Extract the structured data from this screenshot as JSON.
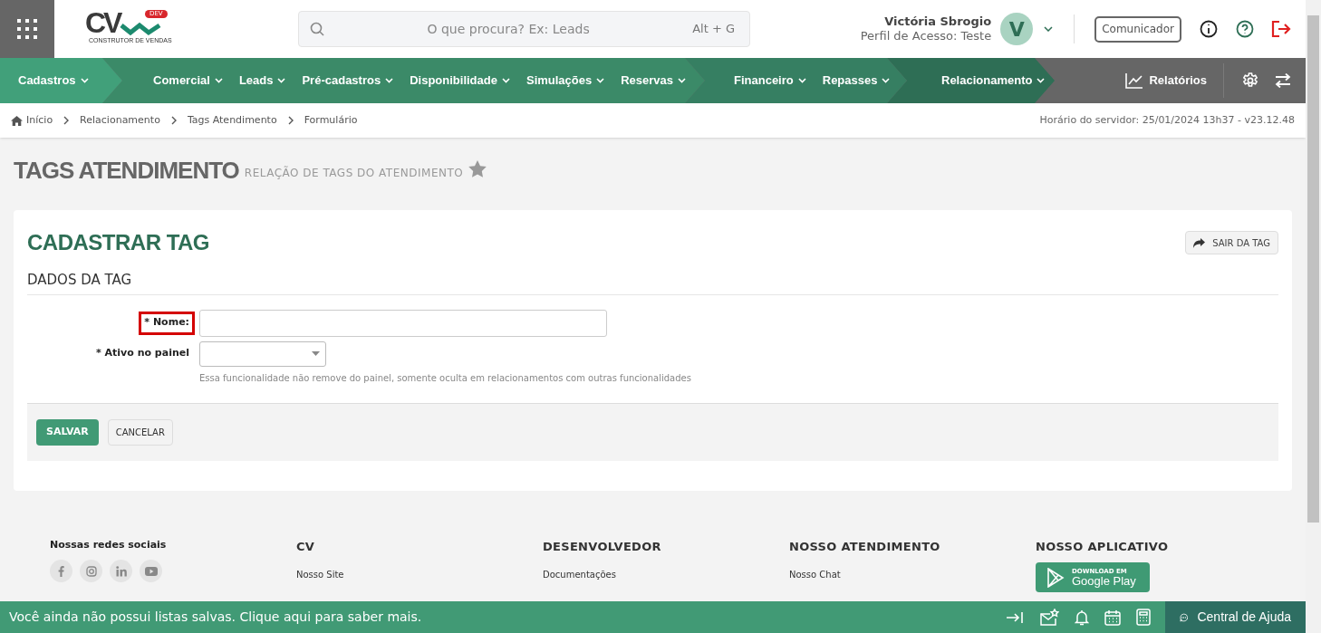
{
  "header": {
    "logo": {
      "mark": "CV",
      "badge": "DEV",
      "tagline": "CONSTRUTOR DE VENDAS"
    },
    "search": {
      "placeholder": "O que procura? Ex: Leads",
      "shortcut": "Alt + G"
    },
    "user": {
      "name": "Victória Sbrogio",
      "profile": "Perfil de Acesso: Teste",
      "initial": "V"
    },
    "communicator": "Comunicador"
  },
  "nav": {
    "groups": [
      {
        "items": [
          "Cadastros"
        ]
      },
      {
        "items": [
          "Comercial",
          "Leads",
          "Pré-cadastros",
          "Disponibilidade",
          "Simulações",
          "Reservas"
        ]
      },
      {
        "items": [
          "Financeiro",
          "Repasses"
        ]
      },
      {
        "items": [
          "Relacionamento"
        ]
      }
    ],
    "reports": "Relatórios"
  },
  "breadcrumb": [
    "Início",
    "Relacionamento",
    "Tags Atendimento",
    "Formulário"
  ],
  "server_time": "Horário do servidor: 25/01/2024 13h37 - v23.12.48",
  "page": {
    "title": "TAGS ATENDIMENTO",
    "subtitle": "RELAÇÃO DE TAGS DO ATENDIMENTO",
    "favorite": false
  },
  "form": {
    "title": "CADASTRAR TAG",
    "exit_button": "SAIR DA TAG",
    "section": "DADOS DA TAG",
    "fields": [
      {
        "kind": "text",
        "label": "* Nome:",
        "highlighted": true
      },
      {
        "kind": "select",
        "label": "* Ativo no painel",
        "highlighted": false,
        "help": "Essa funcionalidade não remove do painel, somente oculta em relacionamentos com outras funcionalidades"
      }
    ],
    "buttons": [
      {
        "label": "SALVAR",
        "kind": "primary"
      },
      {
        "label": "CANCELAR",
        "kind": "default"
      }
    ]
  },
  "footer": {
    "social_title": "Nossas redes sociais",
    "columns": [
      {
        "title": "CV",
        "links": [
          "Nosso Site"
        ]
      },
      {
        "title": "DESENVOLVEDOR",
        "links": [
          "Documentações"
        ]
      },
      {
        "title": "NOSSO ATENDIMENTO",
        "links": [
          "Nosso Chat"
        ]
      }
    ],
    "app": {
      "title": "NOSSO APLICATIVO",
      "small": "DOWNLOAD EM",
      "store": "Google Play"
    }
  },
  "bottom_bar": {
    "message": "Você ainda não possui listas salvas. Clique aqui para saber mais.",
    "help": "Central de Ajuda"
  }
}
